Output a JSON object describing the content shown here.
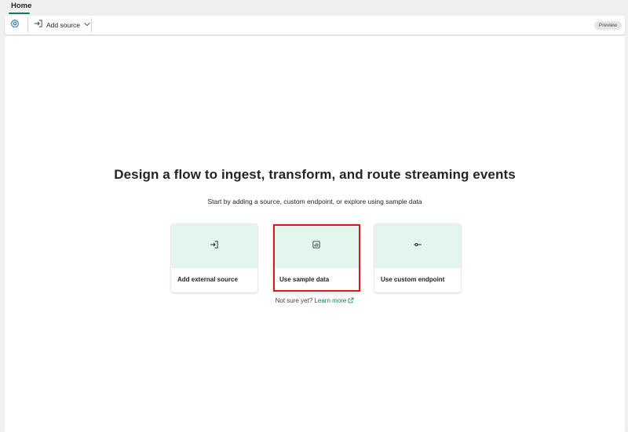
{
  "tabs": [
    {
      "label": "Home",
      "active": true
    }
  ],
  "toolbar": {
    "add_source_label": "Add source",
    "badge": "Preview",
    "icons": [
      "gear-icon",
      "add-source-icon",
      "chevron-down-icon"
    ]
  },
  "main": {
    "heading": "Design a flow to ingest, transform, and route streaming events",
    "subheading": "Start by adding a source, custom endpoint, or explore using sample data",
    "cards": [
      {
        "label": "Add external source",
        "icon": "sign-in-icon"
      },
      {
        "label": "Use sample data",
        "icon": "sample-data-icon",
        "highlighted": true
      },
      {
        "label": "Use custom endpoint",
        "icon": "plug-icon"
      }
    ],
    "help_text": "Not sure yet?",
    "learn_more": "Learn more"
  },
  "colors": {
    "accent": "#117865",
    "card_header": "#e4f5ee",
    "highlight": "#d11a1a",
    "page_background": "#f0f0f0"
  }
}
